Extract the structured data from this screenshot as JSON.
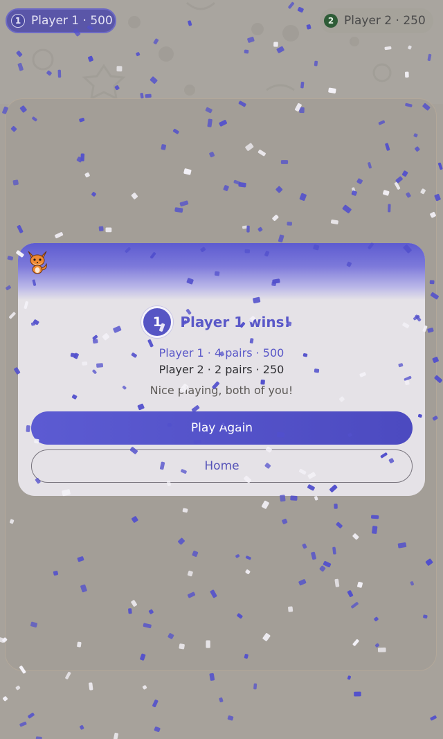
{
  "scoreboard": {
    "player1": {
      "badge": "1",
      "label": "Player 1 · 500"
    },
    "player2": {
      "badge": "2",
      "label": "Player 2 · 250"
    }
  },
  "result_modal": {
    "mascot_icon": "fox-mascot-icon",
    "winner_badge": "1",
    "winner_title": "Player 1 wins!",
    "player1_result": "Player 1 · 4 pairs · 500",
    "player2_result": "Player 2 · 2 pairs · 250",
    "message": "Nice playing, both of you!",
    "play_again_label": "Play Again",
    "home_label": "Home"
  },
  "colors": {
    "accent": "#5a58c8",
    "player1": "#5a56a8",
    "player2": "#2e5c37",
    "confetti_blue": "#5250cc",
    "confetti_white": "#f4f2f8"
  }
}
